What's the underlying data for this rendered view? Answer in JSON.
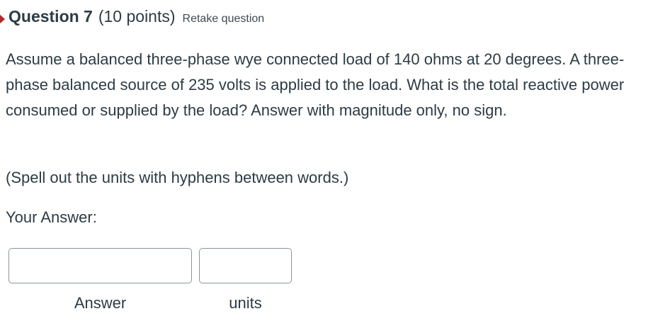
{
  "question": {
    "title": "Question 7",
    "points": "(10 points)",
    "retake_label": "Retake question",
    "flag_color": "#b52b2b",
    "flag_icon": "flag-icon"
  },
  "body": {
    "prompt": "Assume a balanced three-phase wye connected load of 140 ohms at 20 degrees.  A three-phase balanced source of 235 volts is applied to the load.  What is the total reactive power consumed or supplied by the load?  Answer with magnitude only, no sign.",
    "instructions": "(Spell out the units with hyphens between words.)",
    "your_answer_label": "Your Answer:"
  },
  "inputs": {
    "answer": {
      "value": "",
      "label": "Answer"
    },
    "units": {
      "value": "",
      "label": "units"
    }
  }
}
